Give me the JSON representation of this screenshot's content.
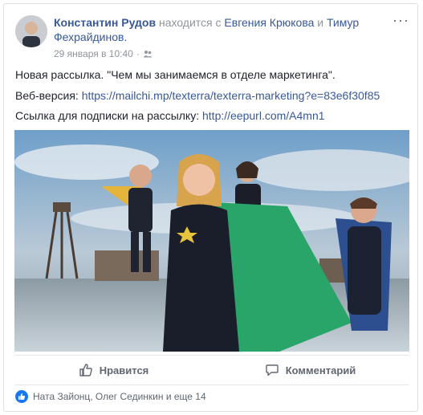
{
  "post": {
    "author": "Константин Рудов",
    "with_text": "находится с",
    "tagged_1": "Евгения Крюкова",
    "and_text": "и",
    "tagged_2": "Тимур Фехрайдинов.",
    "date": "29 января в 10:40",
    "privacy_icon": "friends-icon",
    "line1": "Новая рассылка. \"Чем мы занимаемся в отделе маркетинга\".",
    "web_label": "Веб-версия:",
    "web_url": "https://mailchi.mp/texterra/texterra-marketing?e=83e6f30f85",
    "sub_label": "Ссылка для подписки на рассылку:",
    "sub_url": "http://eepurl.com/A4mn1"
  },
  "actions": {
    "like": "Нравится",
    "comment": "Комментарий"
  },
  "reactions": {
    "text": "Ната Зайонц, Олег Сединкин и еще 14"
  },
  "colors": {
    "link": "#385898",
    "like_blue": "#1877f2"
  }
}
